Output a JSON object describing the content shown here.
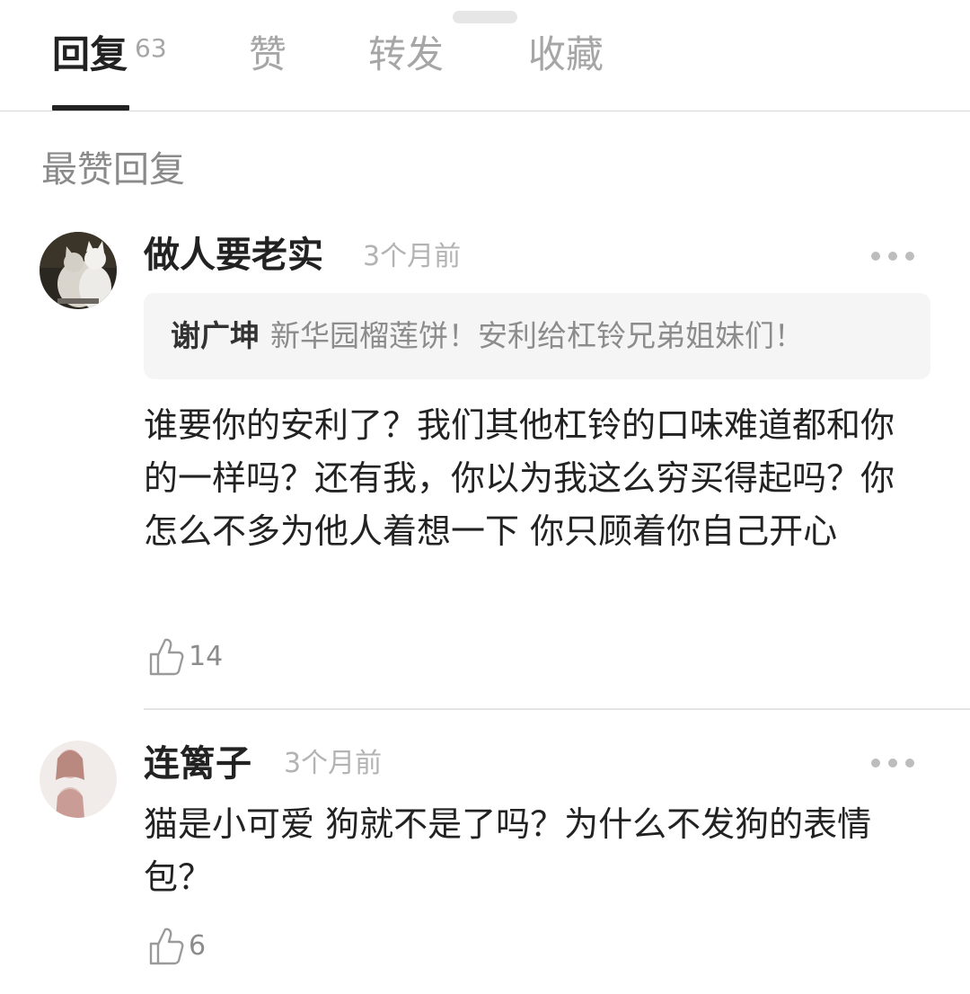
{
  "tabs": [
    {
      "label": "回复",
      "count": "63",
      "active": true
    },
    {
      "label": "赞"
    },
    {
      "label": "转发"
    },
    {
      "label": "收藏"
    }
  ],
  "section_title": "最赞回复",
  "comments": [
    {
      "username": "做人要老实",
      "time": "3个月前",
      "quote_author": "谢广坤",
      "quote_text": "新华园榴莲饼！安利给杠铃兄弟姐妹们！",
      "body": "谁要你的安利了？我们其他杠铃的口味难道都和你的一样吗？还有我，你以为我这么穷买得起吗？你怎么不多为他人着想一下 你只顾着你自己开心",
      "likes": "14"
    },
    {
      "username": "连篱子",
      "time": "3个月前",
      "body": "猫是小可爱 狗就不是了吗？为什么不发狗的表情包？",
      "likes": "6"
    }
  ],
  "icons": {
    "more": "more-dots-icon",
    "like": "thumbs-up-icon"
  }
}
